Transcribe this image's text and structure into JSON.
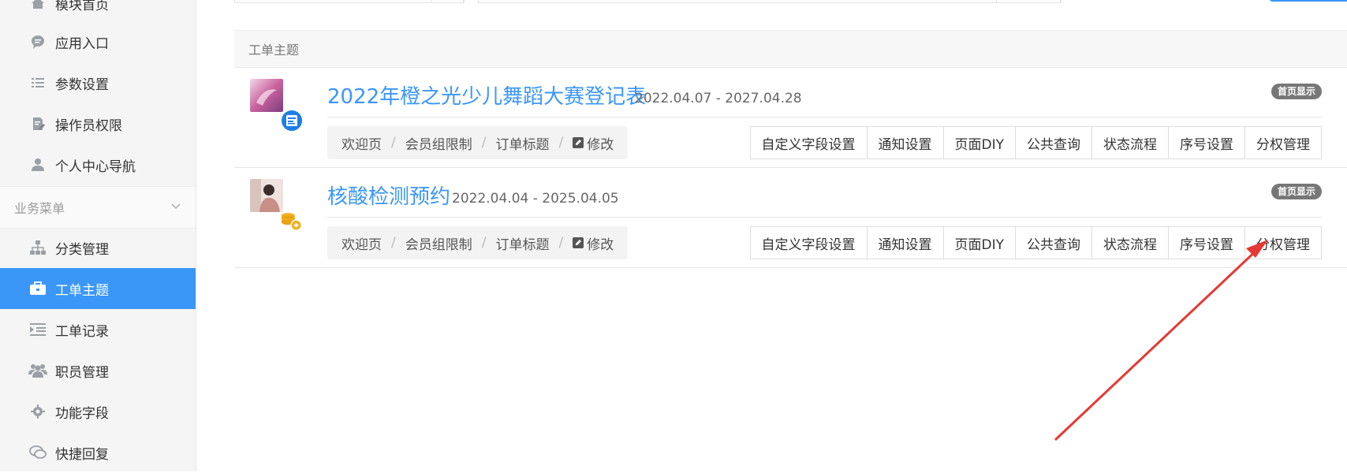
{
  "sidebar": {
    "items": [
      {
        "label": "模块首页",
        "icon": "home-icon"
      },
      {
        "label": "应用入口",
        "icon": "chat-bubble-icon"
      },
      {
        "label": "参数设置",
        "icon": "list-icon"
      },
      {
        "label": "操作员权限",
        "icon": "document-edit-icon"
      },
      {
        "label": "个人中心导航",
        "icon": "user-icon"
      }
    ],
    "group_label": "业务菜单",
    "group_items": [
      {
        "label": "分类管理",
        "icon": "sitemap-icon"
      },
      {
        "label": "工单主题",
        "icon": "briefcase-icon"
      },
      {
        "label": "工单记录",
        "icon": "indent-list-icon"
      },
      {
        "label": "职员管理",
        "icon": "users-icon"
      },
      {
        "label": "功能字段",
        "icon": "gear-icon"
      },
      {
        "label": "快捷回复",
        "icon": "comments-icon"
      }
    ]
  },
  "panel": {
    "title": "工单主题"
  },
  "topics": [
    {
      "title": "2022年橙之光少儿舞蹈大赛登记表",
      "date": "2022.04.07 - 2027.04.28",
      "home_tag": "首页显示",
      "crumbs": [
        "欢迎页",
        "会员组限制",
        "订单标题"
      ],
      "edit_label": "修改",
      "badge_icon": "form-badge-icon",
      "actions": [
        "自定义字段设置",
        "通知设置",
        "页面DIY",
        "公共查询",
        "状态流程",
        "序号设置",
        "分权管理"
      ]
    },
    {
      "title": "核酸检测预约",
      "date": "2022.04.04 - 2025.04.05",
      "home_tag": "首页显示",
      "crumbs": [
        "欢迎页",
        "会员组限制",
        "订单标题"
      ],
      "edit_label": "修改",
      "badge_icon": "coins-badge-icon",
      "actions": [
        "自定义字段设置",
        "通知设置",
        "页面DIY",
        "公共查询",
        "状态流程",
        "序号设置",
        "分权管理"
      ]
    }
  ],
  "colors": {
    "accent": "#3a97f8",
    "arrow": "#e53935",
    "tag": "#777777"
  }
}
